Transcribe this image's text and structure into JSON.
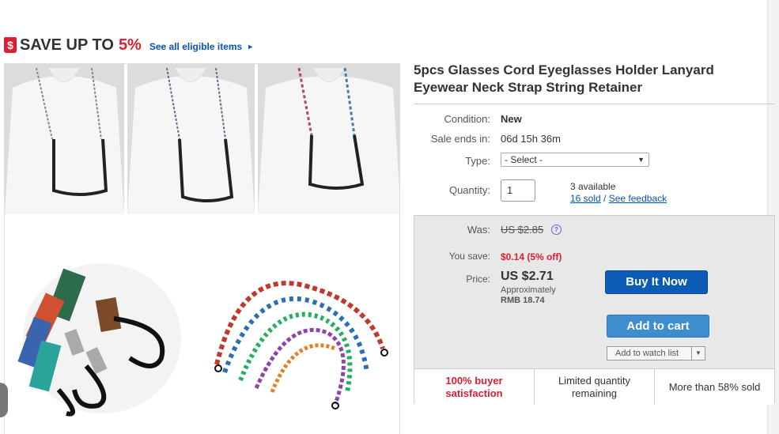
{
  "promo": {
    "badge_icon": "$",
    "save_text": "SAVE UP TO",
    "percent": "5%",
    "link": "See all eligible items",
    "arrow_icon": "►"
  },
  "product": {
    "title": "5pcs Glasses Cord Eyeglasses Holder Lanyard Eyewear Neck Strap String Retainer"
  },
  "details": {
    "condition_label": "Condition:",
    "condition_value": "New",
    "sale_label": "Sale ends in:",
    "sale_value": "06d 15h 36m",
    "type_label": "Type:",
    "type_value": "- Select -",
    "quantity_label": "Quantity:",
    "quantity_value": "1",
    "available": "3 available",
    "sold": "16 sold",
    "separator": "/",
    "feedback": "See feedback"
  },
  "pricing": {
    "was_label": "Was:",
    "was_value": "US $2.85",
    "help_icon": "?",
    "yousave_label": "You save:",
    "yousave_value": "$0.14 (5% off)",
    "price_label": "Price:",
    "price_value": "US $2.71",
    "approx": "Approximately",
    "rmb": "RMB 18.74"
  },
  "actions": {
    "buy_now": "Buy It Now",
    "add_to_cart": "Add to cart",
    "watch": "Add to watch list"
  },
  "badges": {
    "satisfaction": "100% buyer satisfaction",
    "limited": "Limited quantity remaining",
    "sold_pct": "More than 58% sold"
  },
  "colors": {
    "accent_red": "#dd1e31",
    "link_blue": "#0654ba",
    "buy_blue": "#0c5bb5",
    "cart_blue": "#3e8ecf"
  }
}
